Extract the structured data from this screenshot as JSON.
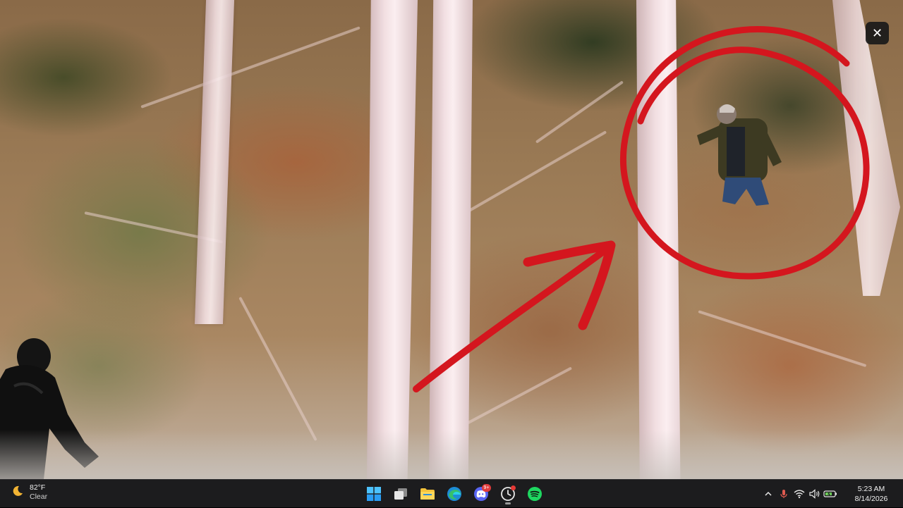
{
  "viewer": {
    "image_description_icon": "photo",
    "close_icon": "close-icon",
    "close_glyph": "✕",
    "annotation_color": "#d4161e"
  },
  "taskbar": {
    "weather": {
      "temp": "82°F",
      "condition": "Clear",
      "icon": "moon-icon"
    },
    "apps": [
      {
        "name": "start-button",
        "icon": "windows-logo-icon"
      },
      {
        "name": "task-view-button",
        "icon": "task-view-icon"
      },
      {
        "name": "file-explorer-app",
        "icon": "folder-icon"
      },
      {
        "name": "edge-app",
        "icon": "edge-icon"
      },
      {
        "name": "discord-app",
        "icon": "discord-icon",
        "badge": "9+"
      },
      {
        "name": "clock-app",
        "icon": "clock-icon"
      },
      {
        "name": "spotify-app",
        "icon": "spotify-icon"
      }
    ],
    "tray": {
      "chevron_glyph": "^",
      "icons": [
        "chevron-up-icon",
        "microphone-icon",
        "wifi-icon",
        "volume-icon",
        "battery-icon"
      ]
    },
    "clock": {
      "time": "5:23 AM",
      "date": "8/14/2026"
    },
    "colors": {
      "taskbar_bg": "#1c1c1e",
      "badge": "#e03b3b",
      "accent": "#f2b434"
    }
  }
}
